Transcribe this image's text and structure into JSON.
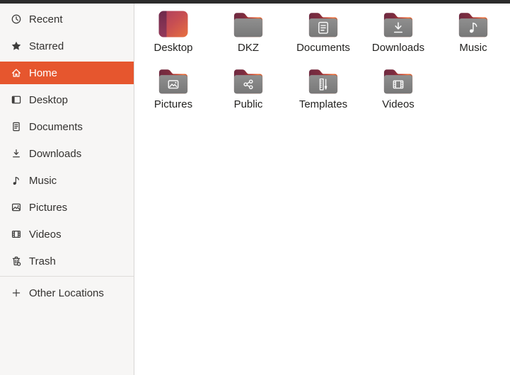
{
  "colors": {
    "accent_orange": "#e6562e",
    "topbar": "#2c2c2c",
    "sidebar_bg": "#f7f6f5",
    "folder_gray": "#7f7f7f",
    "folder_tab_maroon": "#7d2c3f",
    "folder_tab_orange": "#ee6e35"
  },
  "sidebar": {
    "items": [
      {
        "label": "Recent",
        "icon": "clock-icon",
        "selected": false
      },
      {
        "label": "Starred",
        "icon": "star-icon",
        "selected": false
      },
      {
        "label": "Home",
        "icon": "home-icon",
        "selected": true
      },
      {
        "label": "Desktop",
        "icon": "desktop-icon",
        "selected": false
      },
      {
        "label": "Documents",
        "icon": "document-icon",
        "selected": false
      },
      {
        "label": "Downloads",
        "icon": "download-icon",
        "selected": false
      },
      {
        "label": "Music",
        "icon": "music-note-icon",
        "selected": false
      },
      {
        "label": "Pictures",
        "icon": "picture-icon",
        "selected": false
      },
      {
        "label": "Videos",
        "icon": "film-icon",
        "selected": false
      },
      {
        "label": "Trash",
        "icon": "trash-icon",
        "selected": false
      }
    ],
    "other_locations": {
      "label": "Other Locations",
      "icon": "plus-icon"
    }
  },
  "files": {
    "items": [
      {
        "name": "Desktop",
        "icon": "desktop-gradient-icon",
        "glyph": null
      },
      {
        "name": "DKZ",
        "icon": "folder-icon",
        "glyph": null
      },
      {
        "name": "Documents",
        "icon": "folder-icon",
        "glyph": "glyph-document"
      },
      {
        "name": "Downloads",
        "icon": "folder-icon",
        "glyph": "glyph-download"
      },
      {
        "name": "Music",
        "icon": "folder-icon",
        "glyph": "glyph-music"
      },
      {
        "name": "Pictures",
        "icon": "folder-icon",
        "glyph": "glyph-picture"
      },
      {
        "name": "Public",
        "icon": "folder-icon",
        "glyph": "glyph-share"
      },
      {
        "name": "Templates",
        "icon": "folder-icon",
        "glyph": "glyph-template"
      },
      {
        "name": "Videos",
        "icon": "folder-icon",
        "glyph": "glyph-film"
      }
    ]
  }
}
